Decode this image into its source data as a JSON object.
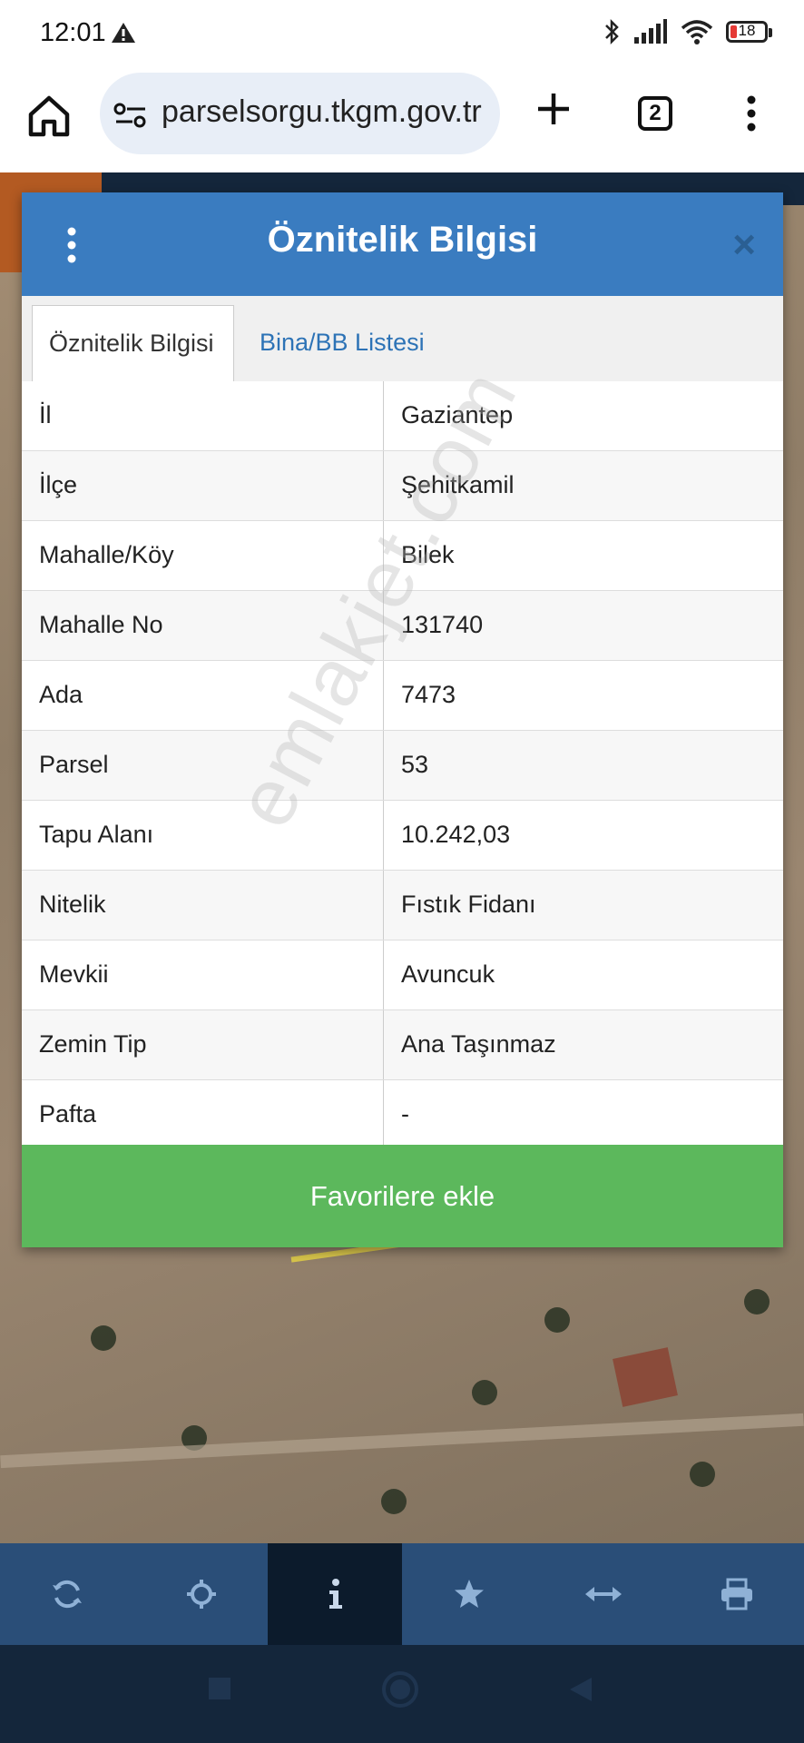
{
  "status_bar": {
    "time": "12:01",
    "battery_level": "18",
    "icons": [
      "warning-icon",
      "bluetooth-icon",
      "signal-icon",
      "wifi-icon",
      "battery-icon"
    ]
  },
  "browser": {
    "url": "parselsorgu.tkgm.gov.tr",
    "tab_count": "2",
    "icons": [
      "home-icon",
      "site-settings-icon",
      "new-tab-icon",
      "tab-switcher-icon",
      "more-menu-icon"
    ]
  },
  "dialog": {
    "title": "Öznitelik Bilgisi",
    "close_label": "×",
    "tabs": [
      {
        "label": "Öznitelik Bilgisi",
        "active": true
      },
      {
        "label": "Bina/BB Listesi",
        "active": false
      }
    ],
    "rows": [
      {
        "key": "İl",
        "value": "Gaziantep"
      },
      {
        "key": "İlçe",
        "value": "Şehitkamil"
      },
      {
        "key": "Mahalle/Köy",
        "value": "Bilek"
      },
      {
        "key": "Mahalle No",
        "value": "131740"
      },
      {
        "key": "Ada",
        "value": "7473"
      },
      {
        "key": "Parsel",
        "value": "53"
      },
      {
        "key": "Tapu Alanı",
        "value": "10.242,03"
      },
      {
        "key": "Nitelik",
        "value": "Fıstık Fidanı"
      },
      {
        "key": "Mevkii",
        "value": "Avuncuk"
      },
      {
        "key": "Zemin Tip",
        "value": "Ana Taşınmaz"
      },
      {
        "key": "Pafta",
        "value": "-"
      }
    ],
    "favorite_button": "Favorilere ekle",
    "header_color": "#3a7cc0",
    "button_color": "#5cb85c"
  },
  "watermark": "emlakjet.com",
  "toolbar": {
    "tools": [
      "refresh-icon",
      "locate-icon",
      "info-icon",
      "favorite-star-icon",
      "measure-icon",
      "print-icon"
    ],
    "active_tool": "info-icon"
  },
  "nav_bar": {
    "buttons": [
      "recents-icon",
      "home-circle-icon",
      "back-icon"
    ]
  }
}
